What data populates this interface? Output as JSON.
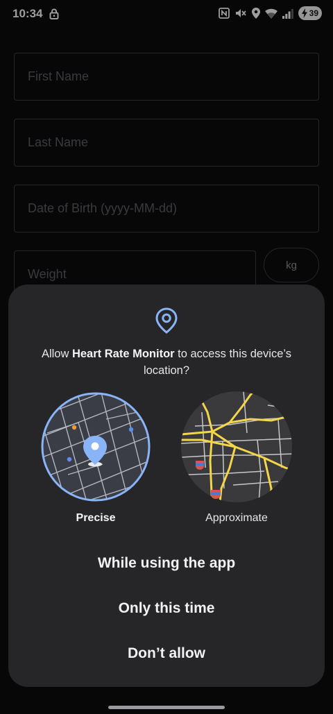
{
  "status_bar": {
    "time": "10:34",
    "battery": "39",
    "icons": [
      "lock-icon",
      "nfc-icon",
      "mute-icon",
      "location-icon",
      "wifi-icon",
      "signal-icon",
      "battery-icon"
    ]
  },
  "form": {
    "first_name_placeholder": "First Name",
    "last_name_placeholder": "Last Name",
    "dob_placeholder": "Date of Birth (yyyy-MM-dd)",
    "weight_placeholder": "Weight",
    "unit_label": "kg"
  },
  "dialog": {
    "title_prefix": "Allow ",
    "app_name": "Heart Rate Monitor",
    "title_suffix": " to access this device’s location?",
    "precise_label": "Precise",
    "approximate_label": "Approximate",
    "while_using_label": "While using the app",
    "only_this_time_label": "Only this time",
    "dont_allow_label": "Don’t allow"
  },
  "colors": {
    "accent": "#8ab4f8",
    "dialog_bg": "#262628",
    "road": "#f3d64a",
    "map_bg": "#3a3a3c"
  }
}
